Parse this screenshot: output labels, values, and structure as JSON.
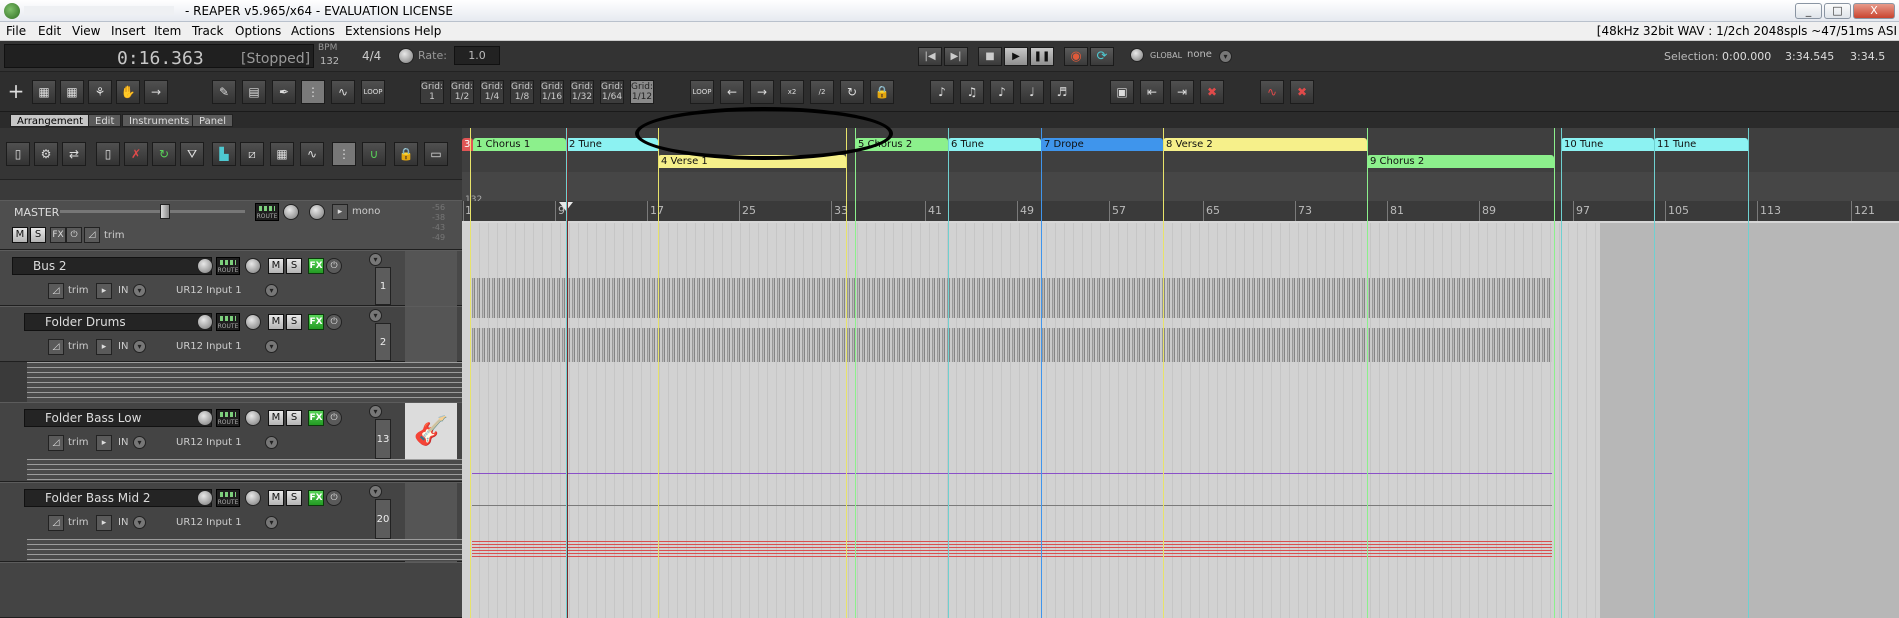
{
  "window": {
    "title": "- REAPER v5.965/x64 - EVALUATION LICENSE",
    "buttons": [
      "_",
      "□",
      "X"
    ]
  },
  "menu": {
    "items": [
      "File",
      "Edit",
      "View",
      "Insert",
      "Item",
      "Track",
      "Options",
      "Actions",
      "Extensions",
      "Help"
    ],
    "status": "[48kHz 32bit WAV : 1/2ch 2048spls ~47/51ms ASI"
  },
  "transport": {
    "time": "0:16.363",
    "state": "[Stopped]",
    "bpm_label": "BPM",
    "bpm": "132",
    "time_sig": "4/4",
    "rate_label": "Rate:",
    "rate": "1.0",
    "global_label": "GLOBAL",
    "global_value": "none",
    "selection_label": "Selection:",
    "selection_start": "0:00.000",
    "selection_end": "3:34.545",
    "selection_len": "3:34.5"
  },
  "toolbar": {
    "grid_buttons": [
      {
        "line1": "Grid:",
        "line2": "1"
      },
      {
        "line1": "Grid:",
        "line2": "1/2"
      },
      {
        "line1": "Grid:",
        "line2": "1/4"
      },
      {
        "line1": "Grid:",
        "line2": "1/8"
      },
      {
        "line1": "Grid:",
        "line2": "1/16"
      },
      {
        "line1": "Grid:",
        "line2": "1/32"
      },
      {
        "line1": "Grid:",
        "line2": "1/64"
      },
      {
        "line1": "Grid:",
        "line2": "1/12"
      }
    ],
    "loop_label": "LOOP"
  },
  "tabs": [
    "Arrangement",
    "Edit",
    "Instruments",
    "Panel"
  ],
  "master": {
    "label": "MASTER",
    "mono": "mono",
    "route": "ROUTE",
    "m": "M",
    "s": "S",
    "fx": "FX",
    "trim": "trim",
    "meter_scale": [
      "-56",
      "-38",
      "-43",
      "-49"
    ]
  },
  "tracks": [
    {
      "name": "Bus 2",
      "input": "UR12 Input 1",
      "number": "1",
      "trim": "trim",
      "in": "IN"
    },
    {
      "name": "Folder Drums",
      "input": "UR12 Input 1",
      "number": "2",
      "trim": "trim",
      "in": "IN"
    },
    {
      "name": "Folder Bass Low",
      "input": "UR12 Input 1",
      "number": "13",
      "trim": "trim",
      "in": "IN"
    },
    {
      "name": "Folder Bass Mid 2",
      "input": "UR12 Input 1",
      "number": "20",
      "trim": "trim",
      "in": "IN"
    }
  ],
  "regions": [
    {
      "label": "1  Chorus 1",
      "color": "#8cf08c",
      "row": 0
    },
    {
      "label": "2  Tune",
      "color": "#8cf2f2",
      "row": 0
    },
    {
      "label": "4  Verse 1",
      "color": "#f6f08a",
      "row": 1
    },
    {
      "label": "5  Chorus 2",
      "color": "#8cf08c",
      "row": 0
    },
    {
      "label": "6  Tune",
      "color": "#8cf2f2",
      "row": 0
    },
    {
      "label": "7  Drope",
      "color": "#3f95ec",
      "row": 0
    },
    {
      "label": "8  Verse 2",
      "color": "#f6f08a",
      "row": 0
    },
    {
      "label": "9  Chorus 2",
      "color": "#8cf08c",
      "row": 1
    },
    {
      "label": "10  Tune",
      "color": "#8cf2f2",
      "row": 0
    },
    {
      "label": "11  Tune",
      "color": "#8cf2f2",
      "row": 0
    }
  ],
  "marker": "3",
  "tempo_marker": "132",
  "timeline": [
    "1",
    "9",
    "17",
    "25",
    "33",
    "41",
    "49",
    "57",
    "65",
    "73",
    "81",
    "89",
    "97",
    "105",
    "113",
    "121"
  ]
}
